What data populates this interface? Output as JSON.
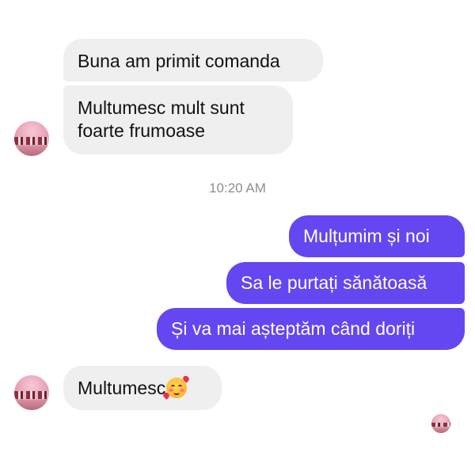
{
  "conversation": {
    "incoming_group_1": [
      "Buna am primit comanda",
      "Multumesc mult sunt",
      "foarte frumoase"
    ],
    "timestamp": "10:20 AM",
    "outgoing": [
      "Mulțumim și noi",
      "Sa le purtați sănătoasă",
      "Și va mai așteptăm când doriți"
    ],
    "incoming_group_2": {
      "text": "Multumesc",
      "emoji": "smiling-face-with-hearts-emoji"
    }
  },
  "colors": {
    "incoming_bubble": "#efeff0",
    "outgoing_bubble": "#6546f0",
    "timestamp": "#8e8e93"
  },
  "icons": {
    "contact_avatar": "contact-avatar",
    "read_receipt": "read-receipt-avatar"
  }
}
